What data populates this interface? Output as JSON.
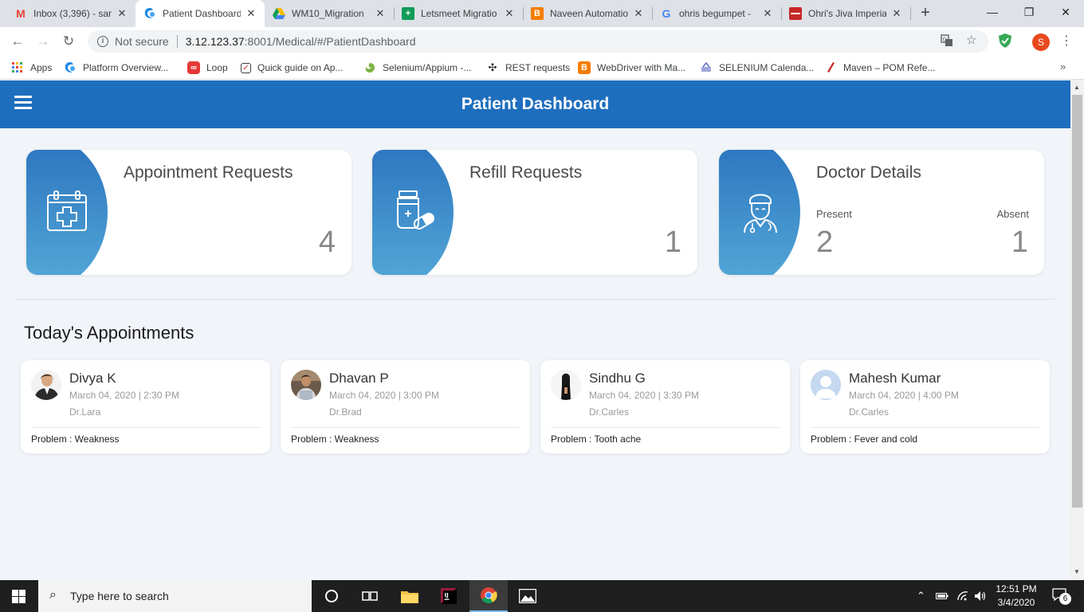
{
  "browser": {
    "tabs": [
      {
        "label": "Inbox (3,396) - san",
        "icon": "gmail-icon",
        "color": "#ea4335",
        "glyph": "M",
        "active": false
      },
      {
        "label": "Patient Dashboard",
        "icon": "app-favicon-icon",
        "color": "#1e88e5",
        "glyph": "",
        "active": true
      },
      {
        "label": "WM10_Migration",
        "icon": "google-drive-icon",
        "color": "#fbbc04",
        "glyph": "",
        "active": false
      },
      {
        "label": "Letsmeet Migratio",
        "icon": "google-sheets-icon",
        "color": "#0f9d58",
        "glyph": "+",
        "active": false
      },
      {
        "label": "Naveen Automatio",
        "icon": "blogger-icon",
        "color": "#f57d00",
        "glyph": "B",
        "active": false
      },
      {
        "label": "ohris begumpet -",
        "icon": "google-icon",
        "color": "#4285f4",
        "glyph": "G",
        "active": false
      },
      {
        "label": "Ohri's Jiva Imperia",
        "icon": "ohris-icon",
        "color": "#c62828",
        "glyph": "",
        "active": false
      }
    ],
    "new_tab_label": "+",
    "address": {
      "security_text": "Not secure",
      "host": "3.12.123.37",
      "path": ":8001/Medical/#/PatientDashboard"
    },
    "profile_initial": "S",
    "bookmarks": [
      {
        "label": "Apps",
        "icon": "apps-grid-icon",
        "color": "#ea4335"
      },
      {
        "label": "Platform Overview...",
        "icon": "platform-icon",
        "color": "#1e88e5"
      },
      {
        "label": "Loop",
        "icon": "loop-icon",
        "color": "#e53935"
      },
      {
        "label": "Quick guide on Ap...",
        "icon": "checkbox-icon",
        "color": "#d32f2f"
      },
      {
        "label": "Selenium/Appium -...",
        "icon": "selenium-icon",
        "color": "#7cb342"
      },
      {
        "label": "REST requests",
        "icon": "rest-icon",
        "color": "#212121"
      },
      {
        "label": "WebDriver with Ma...",
        "icon": "blogger-icon",
        "color": "#f57d00"
      },
      {
        "label": "SELENIUM Calenda...",
        "icon": "calendar-icon",
        "color": "#5c6bc0"
      },
      {
        "label": "Maven – POM Refe...",
        "icon": "maven-icon",
        "color": "#c62828"
      }
    ]
  },
  "app": {
    "title": "Patient Dashboard",
    "stats": {
      "appointment": {
        "title": "Appointment Requests",
        "value": "4"
      },
      "refill": {
        "title": "Refill Requests",
        "value": "1"
      },
      "doctor": {
        "title": "Doctor Details",
        "present_label": "Present",
        "present_value": "2",
        "absent_label": "Absent",
        "absent_value": "1"
      }
    },
    "section_title": "Today's Appointments",
    "appointments": [
      {
        "name": "Divya K",
        "datetime": "March 04, 2020 | 2:30 PM",
        "doctor": "Dr.Lara",
        "problem": "Problem : Weakness"
      },
      {
        "name": "Dhavan P",
        "datetime": "March 04, 2020 | 3:00 PM",
        "doctor": "Dr.Brad",
        "problem": "Problem : Weakness"
      },
      {
        "name": "Sindhu G",
        "datetime": "March 04, 2020 | 3:30 PM",
        "doctor": "Dr.Carles",
        "problem": "Problem : Tooth ache"
      },
      {
        "name": "Mahesh Kumar",
        "datetime": "March 04, 2020 | 4:00 PM",
        "doctor": "Dr.Carles",
        "problem": "Problem : Fever and cold"
      }
    ]
  },
  "taskbar": {
    "search_placeholder": "Type here to search",
    "time": "12:51 PM",
    "date": "3/4/2020",
    "notification_count": "6"
  },
  "colors": {
    "header": "#1e6ebe",
    "card_gradient_top": "#2a72be",
    "card_gradient_bottom": "#55aad8"
  }
}
